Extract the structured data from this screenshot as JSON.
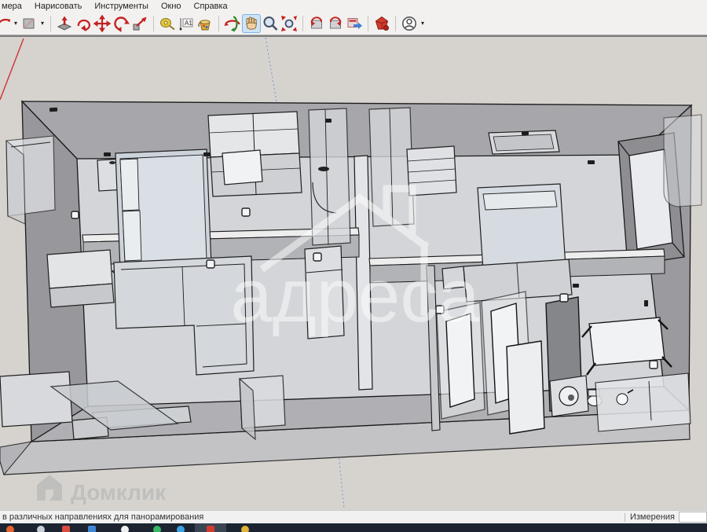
{
  "menu": {
    "items": [
      "мера",
      "Нарисовать",
      "Инструменты",
      "Окно",
      "Справка"
    ]
  },
  "toolbar": {
    "active_tool": "pan",
    "tools": [
      "arc-tool",
      "shapes-tool",
      "push-pull-tool",
      "follow-me-tool",
      "move-tool",
      "rotate-tool",
      "scale-tool",
      "tape-measure-tool",
      "dimensions-tool",
      "paint-bucket-tool",
      "orbit-tool",
      "pan-tool",
      "zoom-tool",
      "zoom-extents-tool",
      "previous-view",
      "next-view",
      "share-view",
      "license",
      "account"
    ]
  },
  "viewport": {
    "watermark_center": "адреса",
    "watermark_logo": "Домклик"
  },
  "statusbar": {
    "hint": "в различных направлениях для панорамирования",
    "measurements_label": "Измерения",
    "measurements_value": ""
  },
  "colors": {
    "viewport_background": "#d6d3cf",
    "axis_red": "#cc3333",
    "axis_blue": "#7a8fd4",
    "tool_red": "#c42222",
    "pan_highlight": "#cfe3f6",
    "taskbar": "#1b2430",
    "edge": "#1a1a1a"
  }
}
